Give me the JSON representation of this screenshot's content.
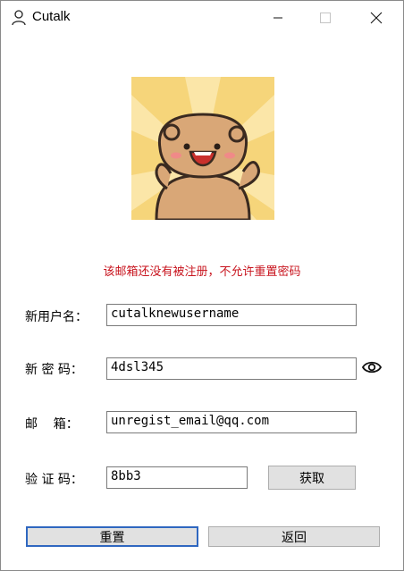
{
  "window": {
    "title": "Cutalk"
  },
  "message": "该邮箱还没有被注册，不允许重置密码",
  "form": {
    "username": {
      "label": "新用户名：",
      "value": "cutalknewusername"
    },
    "password": {
      "label": "新 密 码：",
      "value": "4dsl345"
    },
    "email": {
      "label": "邮    箱：",
      "value": "unregist_email@qq.com"
    },
    "code": {
      "label": "验 证 码：",
      "value": "8bb3"
    }
  },
  "buttons": {
    "get_code": "获取",
    "reset": "重置",
    "back": "返回"
  },
  "colors": {
    "error_text": "#c8141e",
    "focus_border": "#2f67c0",
    "button_bg": "#e1e1e1"
  },
  "icons": {
    "app": "user-icon",
    "toggle_password": "eye-icon"
  }
}
